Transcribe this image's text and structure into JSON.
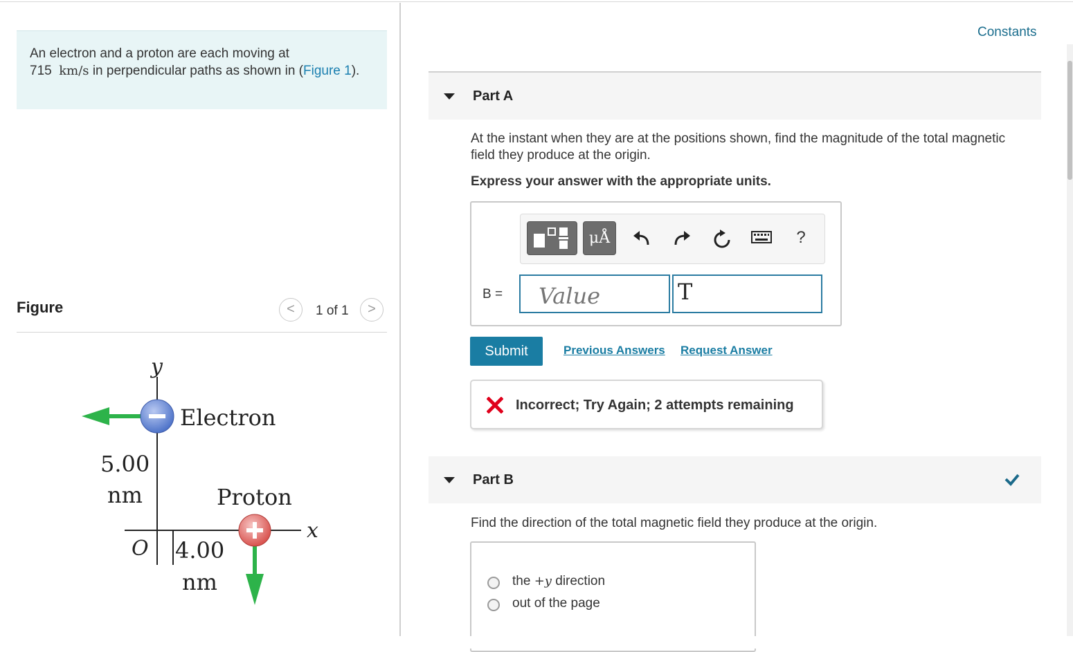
{
  "problem": {
    "intro_prefix": "An electron and a proton are each moving at",
    "speed_value": "715",
    "speed_units": "km/s",
    "intro_suffix": " in perpendicular paths as shown in (",
    "figure_link": "Figure 1",
    "intro_end": ")."
  },
  "figure_panel": {
    "title": "Figure",
    "pager_count": "1 of 1",
    "prev_symbol": "<",
    "next_symbol": ">",
    "labels": {
      "y_axis": "y",
      "x_axis": "x",
      "origin": "O",
      "electron": "Electron",
      "proton": "Proton",
      "vertical_distance": "5.00",
      "vertical_unit": "nm",
      "horizontal_distance": "4.00",
      "horizontal_unit": "nm"
    },
    "colors": {
      "arrow": "#2db34a",
      "electron": "#4f74c9",
      "proton": "#d9534f"
    }
  },
  "header": {
    "constants_link": "Constants"
  },
  "part_a": {
    "title": "Part A",
    "question": "At the instant when they are at the positions shown, find the magnitude of the total magnetic field they produce at the origin.",
    "instruction": "Express your answer with the appropriate units.",
    "toolbar": {
      "templates_icon": "templates-icon",
      "units_label": "μÅ",
      "undo_icon": "undo-icon",
      "redo_icon": "redo-icon",
      "reset_icon": "reset-icon",
      "keyboard_icon": "keyboard-icon",
      "help_label": "?"
    },
    "variable_label": "B =",
    "value_placeholder": "Value",
    "unit_value": "T",
    "submit_label": "Submit",
    "previous_answers_label": "Previous Answers",
    "request_answer_label": "Request Answer",
    "feedback": "Incorrect; Try Again; 2 attempts remaining"
  },
  "part_b": {
    "title": "Part B",
    "status_icon": "checkmark-icon",
    "question": "Find the direction of the total magnetic field they produce at the origin.",
    "choices": [
      {
        "prefix": "the ",
        "math": "+y",
        "suffix": " direction"
      },
      {
        "prefix": "out of the page",
        "math": "",
        "suffix": ""
      }
    ]
  },
  "colors": {
    "link": "#1a7fb0",
    "submit_bg": "#1a7da3",
    "intro_bg": "#e8f5f6",
    "error": "#e0001b",
    "success": "#1b6a8a"
  }
}
